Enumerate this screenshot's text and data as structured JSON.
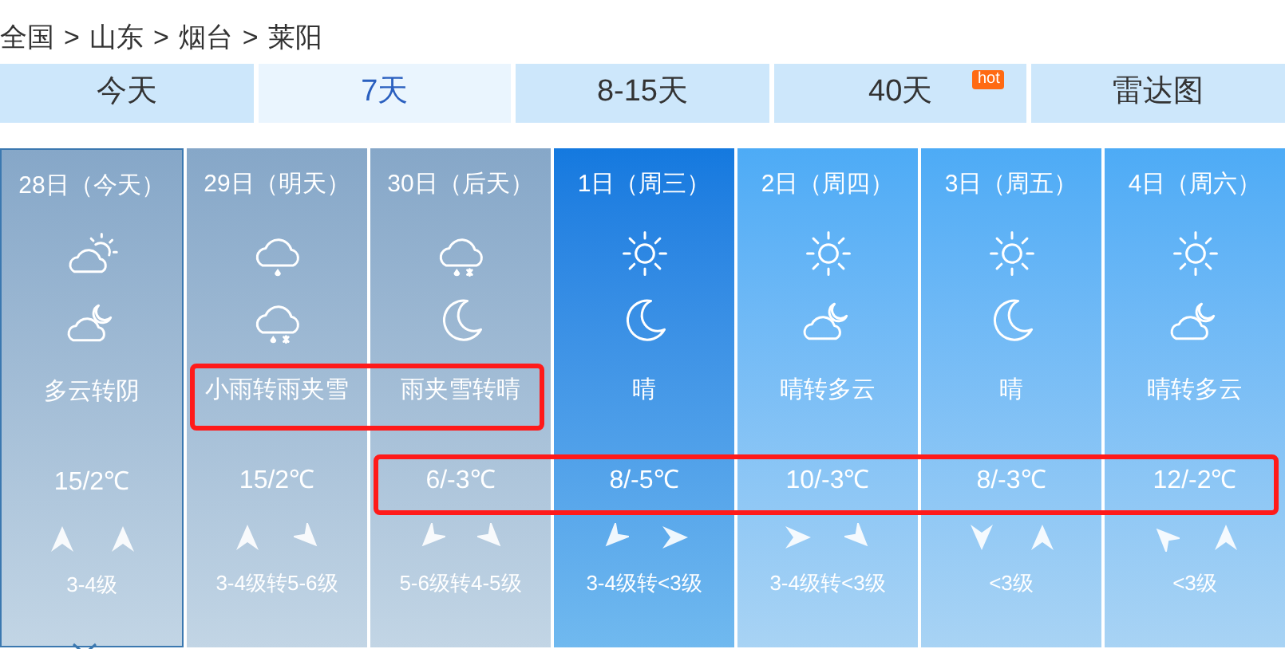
{
  "breadcrumb": [
    "全国",
    "山东",
    "烟台",
    "莱阳"
  ],
  "breadcrumb_separator": ">",
  "tabs": [
    {
      "label": "今天",
      "selected": false
    },
    {
      "label": "7天",
      "selected": true
    },
    {
      "label": "8-15天",
      "selected": false
    },
    {
      "label": "40天",
      "selected": false,
      "badge": "hot"
    },
    {
      "label": "雷达图",
      "selected": false
    }
  ],
  "days": [
    {
      "date": "28日（今天）",
      "kind": "past",
      "selected": true,
      "weather": "多云转阴",
      "temp": "15/2℃",
      "wind": "3-4级"
    },
    {
      "date": "29日（明天）",
      "kind": "past",
      "selected": false,
      "weather": "小雨转雨夹雪",
      "temp": "15/2℃",
      "wind": "3-4级转5-6级"
    },
    {
      "date": "30日（后天）",
      "kind": "past",
      "selected": false,
      "weather": "雨夹雪转晴",
      "temp": "6/-3℃",
      "wind": "5-6级转4-5级"
    },
    {
      "date": "1日（周三）",
      "kind": "current",
      "selected": false,
      "weather": "晴",
      "temp": "8/-5℃",
      "wind": "3-4级转<3级"
    },
    {
      "date": "2日（周四）",
      "kind": "future",
      "selected": false,
      "weather": "晴转多云",
      "temp": "10/-3℃",
      "wind": "3-4级转<3级"
    },
    {
      "date": "3日（周五）",
      "kind": "future",
      "selected": false,
      "weather": "晴",
      "temp": "8/-3℃",
      "wind": "<3级"
    },
    {
      "date": "4日（周六）",
      "kind": "future",
      "selected": false,
      "weather": "晴转多云",
      "temp": "12/-2℃",
      "wind": "<3级"
    }
  ]
}
